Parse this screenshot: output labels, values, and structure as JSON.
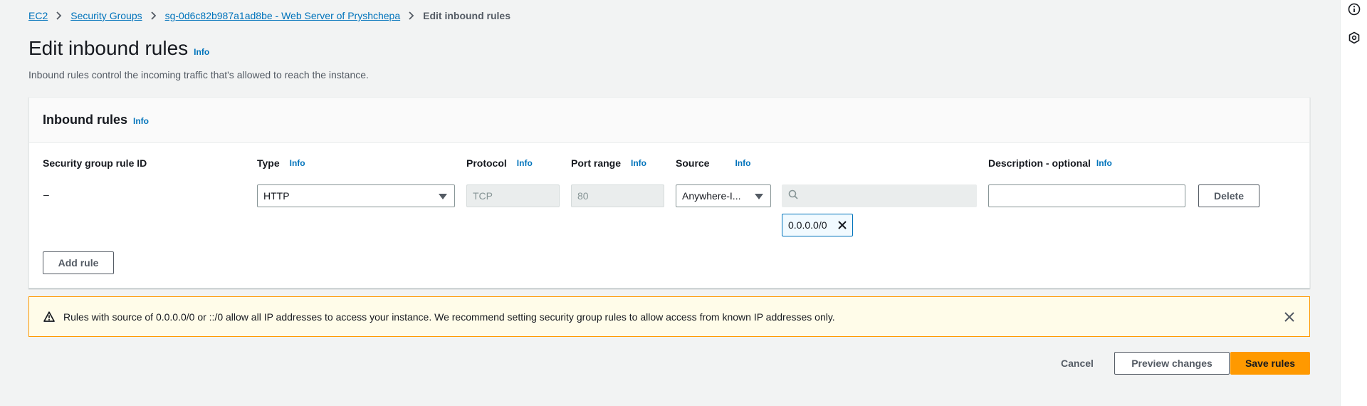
{
  "breadcrumb": [
    {
      "label": "EC2"
    },
    {
      "label": "Security Groups"
    },
    {
      "label": "sg-0d6c82b987a1ad8be - Web Server of Pryshchepa"
    },
    {
      "label": "Edit inbound rules"
    }
  ],
  "page": {
    "title": "Edit inbound rules",
    "info": "Info",
    "description": "Inbound rules control the incoming traffic that's allowed to reach the instance."
  },
  "panel": {
    "title": "Inbound rules",
    "info": "Info",
    "columns": {
      "rule_id": "Security group rule ID",
      "type": "Type",
      "protocol": "Protocol",
      "port_range": "Port range",
      "source": "Source",
      "description": "Description - optional",
      "info": "Info"
    },
    "rows": [
      {
        "rule_id": "–",
        "type": "HTTP",
        "protocol": "TCP",
        "port_range": "80",
        "source": "Anywhere-I...",
        "source_search_value": "",
        "cidr_token": "0.0.0.0/0",
        "description_value": "",
        "delete_label": "Delete"
      }
    ],
    "add_rule_label": "Add rule"
  },
  "alert": {
    "text": "Rules with source of 0.0.0.0/0 or ::/0 allow all IP addresses to access your instance. We recommend setting security group rules to allow access from known IP addresses only.",
    "icon": "warning-icon"
  },
  "actions": {
    "cancel": "Cancel",
    "preview": "Preview changes",
    "save": "Save rules"
  },
  "colors": {
    "link": "#0073bb",
    "primary": "#ff9900",
    "warning_bg": "#fffce9",
    "background": "#f2f3f3"
  },
  "rail_icons": [
    "info-icon",
    "settings-hexagon-icon"
  ]
}
